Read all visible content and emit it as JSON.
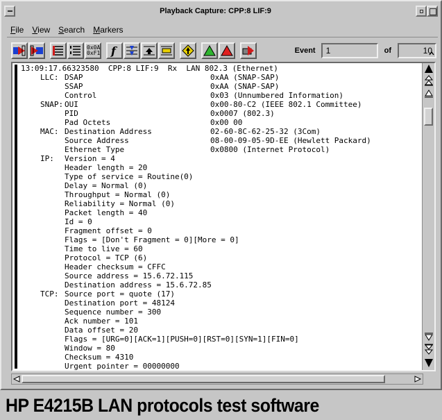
{
  "window": {
    "title": "Playback Capture: CPP:8 LIF:9"
  },
  "menu": {
    "items": [
      {
        "first": "F",
        "rest": "ile"
      },
      {
        "first": "V",
        "rest": "iew"
      },
      {
        "first": "S",
        "rest": "earch"
      },
      {
        "first": "M",
        "rest": "arkers"
      }
    ]
  },
  "toolbar": {
    "buttons": [
      {
        "name": "playback-import-icon"
      },
      {
        "name": "playback-export-icon"
      },
      {
        "name": "summary-view-icon"
      },
      {
        "name": "detail-view-icon"
      },
      {
        "name": "hex-view-icon",
        "label": "0x0A 0xF1"
      },
      {
        "name": "filter-function-icon"
      },
      {
        "name": "protocol-stack-icon"
      },
      {
        "name": "marker-up-icon"
      },
      {
        "name": "marker-down-icon"
      },
      {
        "name": "goto-event-icon"
      },
      {
        "name": "green-flag-icon"
      },
      {
        "name": "red-flag-icon"
      },
      {
        "name": "print-capture-icon"
      }
    ],
    "event_label": "Event",
    "event_value": "1",
    "of_label": "of",
    "event_total": "10"
  },
  "packet": {
    "header": "13:09:17.66323580  CPP:8 LIF:9  Rx  LAN 802.3 (Ethernet)",
    "rows": [
      {
        "layer": "LLC:",
        "field": "DSAP",
        "value": "0xAA (SNAP-SAP)"
      },
      {
        "layer": "",
        "field": "SSAP",
        "value": "0xAA (SNAP-SAP)"
      },
      {
        "layer": "",
        "field": "Control",
        "value": "0x03 (Unnumbered Information)"
      },
      {
        "layer": "SNAP:",
        "field": "OUI",
        "value": "0x00-80-C2 (IEEE 802.1 Committee)"
      },
      {
        "layer": "",
        "field": "PID",
        "value": "0x0007 (802.3)"
      },
      {
        "layer": "",
        "field": "Pad Octets",
        "value": "0x00 00"
      },
      {
        "layer": "MAC:",
        "field": "Destination Address",
        "value": "02-60-8C-62-25-32 (3Com)"
      },
      {
        "layer": "",
        "field": "Source Address",
        "value": "08-00-09-05-9D-EE (Hewlett Packard)"
      },
      {
        "layer": "",
        "field": "Ethernet Type",
        "value": "0x0800 (Internet Protocol)"
      },
      {
        "layer": "IP:",
        "field": "Version = 4",
        "value": ""
      },
      {
        "layer": "",
        "field": "Header length = 20",
        "value": ""
      },
      {
        "layer": "",
        "field": "Type of service = Routine(0)",
        "value": ""
      },
      {
        "layer": "",
        "field": "Delay = Normal (0)",
        "value": ""
      },
      {
        "layer": "",
        "field": "Throughput = Normal (0)",
        "value": ""
      },
      {
        "layer": "",
        "field": "Reliability = Normal (0)",
        "value": ""
      },
      {
        "layer": "",
        "field": "Packet length = 40",
        "value": ""
      },
      {
        "layer": "",
        "field": "Id = 0",
        "value": ""
      },
      {
        "layer": "",
        "field": "Fragment offset = 0",
        "value": ""
      },
      {
        "layer": "",
        "field": "Flags = [Don't Fragment = 0][More = 0]",
        "value": ""
      },
      {
        "layer": "",
        "field": "Time to live = 60",
        "value": ""
      },
      {
        "layer": "",
        "field": "Protocol = TCP (6)",
        "value": ""
      },
      {
        "layer": "",
        "field": "Header checksum = CFFC",
        "value": ""
      },
      {
        "layer": "",
        "field": "Source address = 15.6.72.115",
        "value": ""
      },
      {
        "layer": "",
        "field": "Destination address = 15.6.72.85",
        "value": ""
      },
      {
        "layer": "TCP:",
        "field": "Source port = quote (17)",
        "value": ""
      },
      {
        "layer": "",
        "field": "Destination port = 48124",
        "value": ""
      },
      {
        "layer": "",
        "field": "Sequence number = 300",
        "value": ""
      },
      {
        "layer": "",
        "field": "Ack number = 101",
        "value": ""
      },
      {
        "layer": "",
        "field": "Data offset = 20",
        "value": ""
      },
      {
        "layer": "",
        "field": "Flags = [URG=0][ACK=1][PUSH=0][RST=0][SYN=1][FIN=0]",
        "value": ""
      },
      {
        "layer": "",
        "field": "Window = 80",
        "value": ""
      },
      {
        "layer": "",
        "field": "Checksum = 4310",
        "value": ""
      },
      {
        "layer": "",
        "field": "Urgent pointer = 00000000",
        "value": ""
      }
    ]
  },
  "caption": "HP E4215B LAN protocols test software",
  "colors": {
    "chrome": "#c6c6c6",
    "content_bg": "#ffffff",
    "green_flag": "#2fb52f",
    "red_flag": "#e02020",
    "accent_blue": "#1a3fd0",
    "accent_red": "#d01a1a",
    "goto_yellow": "#e8d000"
  }
}
